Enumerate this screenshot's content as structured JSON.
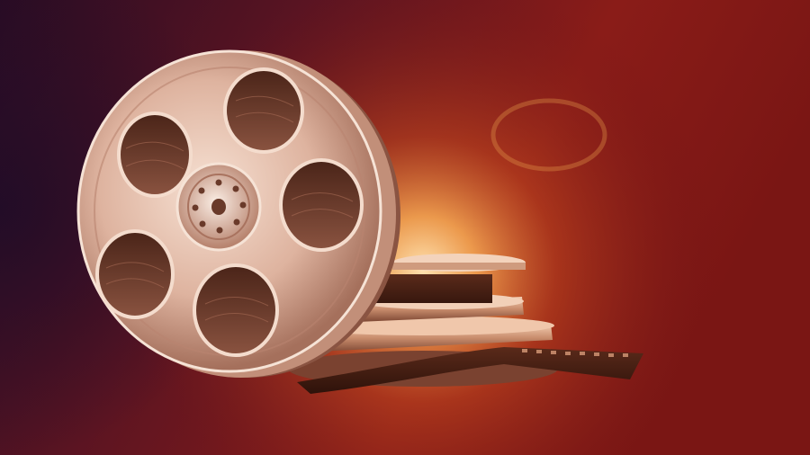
{
  "scene": {
    "subject": "film-reel-icon",
    "elements": [
      "background-glow",
      "film-reel",
      "stacked-film-cans",
      "film-strip"
    ],
    "colors": {
      "background_dark": "#2a0c1e",
      "background_red": "#8a1a18",
      "glow_center": "#ffd8a0",
      "glow_orange": "#e06a22",
      "reel_light": "#f1d4c2",
      "reel_mid": "#c99a86",
      "reel_dark": "#6a3d2e",
      "film_dark": "#3b1810"
    }
  }
}
